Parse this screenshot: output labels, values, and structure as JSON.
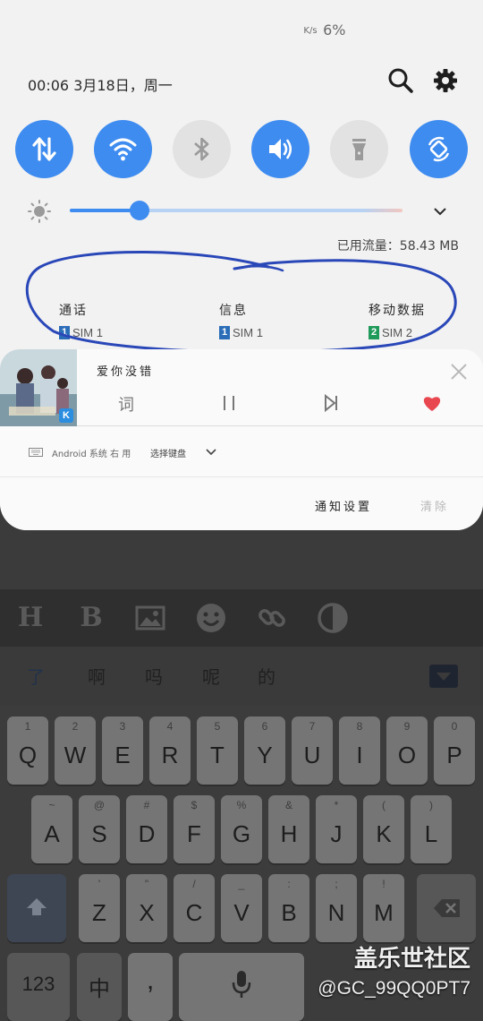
{
  "status_bar": {
    "net_unit": "K/s",
    "battery": "6%"
  },
  "header": {
    "datetime": "00:06  3月18日，周一"
  },
  "quick_settings": [
    {
      "name": "mobile-data",
      "icon": "data-transfer-icon",
      "active": true
    },
    {
      "name": "wifi",
      "icon": "wifi-icon",
      "active": true
    },
    {
      "name": "bluetooth",
      "icon": "bluetooth-icon",
      "active": false
    },
    {
      "name": "sound",
      "icon": "volume-icon",
      "active": true
    },
    {
      "name": "flashlight",
      "icon": "flashlight-icon",
      "active": false
    },
    {
      "name": "auto-rotate",
      "icon": "rotate-icon",
      "active": true
    }
  ],
  "brightness": {
    "level": 0.21
  },
  "data_usage": "已用流量：58.43 MB",
  "sim": [
    {
      "title": "通话",
      "badge": "1",
      "label": "SIM 1",
      "color": "#2c6db8"
    },
    {
      "title": "信息",
      "badge": "1",
      "label": "SIM 1",
      "color": "#2c6db8"
    },
    {
      "title": "移动数据",
      "badge": "2",
      "label": "SIM 2",
      "color": "#1f9a5a"
    }
  ],
  "music": {
    "title": "爱你没错",
    "lyrics_label": "词",
    "app_badge": "K"
  },
  "ime_notification": {
    "text": "Android 系统 右 用",
    "select_label": "选择键盘"
  },
  "actions": {
    "settings": "通知设置",
    "clear": "清除"
  },
  "candidates": [
    "了",
    "啊",
    "吗",
    "呢",
    "的"
  ],
  "keyboard": {
    "row1": [
      {
        "main": "Q",
        "sub": "1"
      },
      {
        "main": "W",
        "sub": "2"
      },
      {
        "main": "E",
        "sub": "3"
      },
      {
        "main": "R",
        "sub": "4"
      },
      {
        "main": "T",
        "sub": "5"
      },
      {
        "main": "Y",
        "sub": "6"
      },
      {
        "main": "U",
        "sub": "7"
      },
      {
        "main": "I",
        "sub": "8"
      },
      {
        "main": "O",
        "sub": "9"
      },
      {
        "main": "P",
        "sub": "0"
      }
    ],
    "row2": [
      {
        "main": "A",
        "sub": "~"
      },
      {
        "main": "S",
        "sub": "@"
      },
      {
        "main": "D",
        "sub": "#"
      },
      {
        "main": "F",
        "sub": "$"
      },
      {
        "main": "G",
        "sub": "%"
      },
      {
        "main": "H",
        "sub": "&"
      },
      {
        "main": "J",
        "sub": "*"
      },
      {
        "main": "K",
        "sub": "("
      },
      {
        "main": "L",
        "sub": ")"
      }
    ],
    "row3": [
      {
        "main": "Z",
        "sub": "'"
      },
      {
        "main": "X",
        "sub": "\""
      },
      {
        "main": "C",
        "sub": "/"
      },
      {
        "main": "V",
        "sub": "_"
      },
      {
        "main": "B",
        "sub": ":"
      },
      {
        "main": "N",
        "sub": ";"
      },
      {
        "main": "M",
        "sub": "!"
      }
    ],
    "num_key": "123",
    "lang_key": "中",
    "comma_key": ","
  },
  "watermark": {
    "line1": "盖乐世社区",
    "line2": "@GC_99QQ0PT7"
  },
  "colors": {
    "accent": "#3f8cf0",
    "heart": "#e8474f"
  }
}
